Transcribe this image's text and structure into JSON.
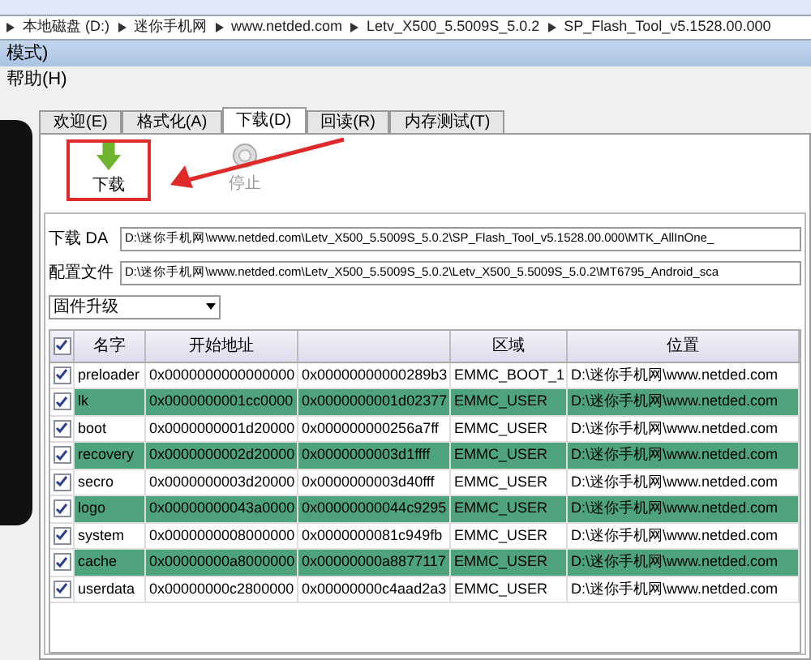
{
  "breadcrumb": [
    "本地磁盘 (D:)",
    "迷你手机网",
    "www.netded.com",
    "Letv_X500_5.5009S_5.0.2",
    "SP_Flash_Tool_v5.1528.00.000"
  ],
  "window": {
    "title": "模式)"
  },
  "menu": [
    "帮助(H)"
  ],
  "tabs": [
    {
      "label": "欢迎(E)",
      "selected": false
    },
    {
      "label": "格式化(A)",
      "selected": false
    },
    {
      "label": "下载(D)",
      "selected": true
    },
    {
      "label": "回读(R)",
      "selected": false
    },
    {
      "label": "内存测试(T)",
      "selected": false
    }
  ],
  "toolbar": [
    {
      "kind": "download",
      "label": "下载",
      "disabled": false,
      "highlighted": true
    },
    {
      "kind": "stop",
      "label": "停止",
      "disabled": true,
      "highlighted": false
    }
  ],
  "fields": [
    {
      "label": "下载 DA",
      "value": "D:\\迷你手机网\\www.netded.com\\Letv_X500_5.5009S_5.0.2\\SP_Flash_Tool_v5.1528.00.000\\MTK_AllInOne_"
    },
    {
      "label": "配置文件",
      "value": "D:\\迷你手机网\\www.netded.com\\Letv_X500_5.5009S_5.0.2\\Letv_X500_5.5009S_5.0.2\\MT6795_Android_sca"
    }
  ],
  "mode_select": {
    "value": "固件升级"
  },
  "table": {
    "all_checked": true,
    "columns": [
      "名字",
      "开始地址",
      "",
      "区域",
      "位置"
    ],
    "rows": [
      {
        "checked": true,
        "highlighted": false,
        "cells": [
          "preloader",
          "0x0000000000000000",
          "0x00000000000289b3",
          "EMMC_BOOT_1",
          "D:\\迷你手机网\\www.netded.com"
        ]
      },
      {
        "checked": true,
        "highlighted": true,
        "cells": [
          "lk",
          "0x0000000001cc0000",
          "0x0000000001d02377",
          "EMMC_USER",
          "D:\\迷你手机网\\www.netded.com"
        ]
      },
      {
        "checked": true,
        "highlighted": false,
        "cells": [
          "boot",
          "0x0000000001d20000",
          "0x000000000256a7ff",
          "EMMC_USER",
          "D:\\迷你手机网\\www.netded.com"
        ]
      },
      {
        "checked": true,
        "highlighted": true,
        "cells": [
          "recovery",
          "0x0000000002d20000",
          "0x0000000003d1ffff",
          "EMMC_USER",
          "D:\\迷你手机网\\www.netded.com"
        ]
      },
      {
        "checked": true,
        "highlighted": false,
        "cells": [
          "secro",
          "0x0000000003d20000",
          "0x0000000003d40fff",
          "EMMC_USER",
          "D:\\迷你手机网\\www.netded.com"
        ]
      },
      {
        "checked": true,
        "highlighted": true,
        "cells": [
          "logo",
          "0x00000000043a0000",
          "0x00000000044c9295",
          "EMMC_USER",
          "D:\\迷你手机网\\www.netded.com"
        ]
      },
      {
        "checked": true,
        "highlighted": false,
        "cells": [
          "system",
          "0x0000000008000000",
          "0x0000000081c949fb",
          "EMMC_USER",
          "D:\\迷你手机网\\www.netded.com"
        ]
      },
      {
        "checked": true,
        "highlighted": true,
        "cells": [
          "cache",
          "0x00000000a8000000",
          "0x00000000a8877117",
          "EMMC_USER",
          "D:\\迷你手机网\\www.netded.com"
        ]
      },
      {
        "checked": true,
        "highlighted": false,
        "cells": [
          "userdata",
          "0x00000000c2800000",
          "0x00000000c4aad2a3",
          "EMMC_USER",
          "D:\\迷你手机网\\www.netded.com"
        ]
      }
    ]
  }
}
